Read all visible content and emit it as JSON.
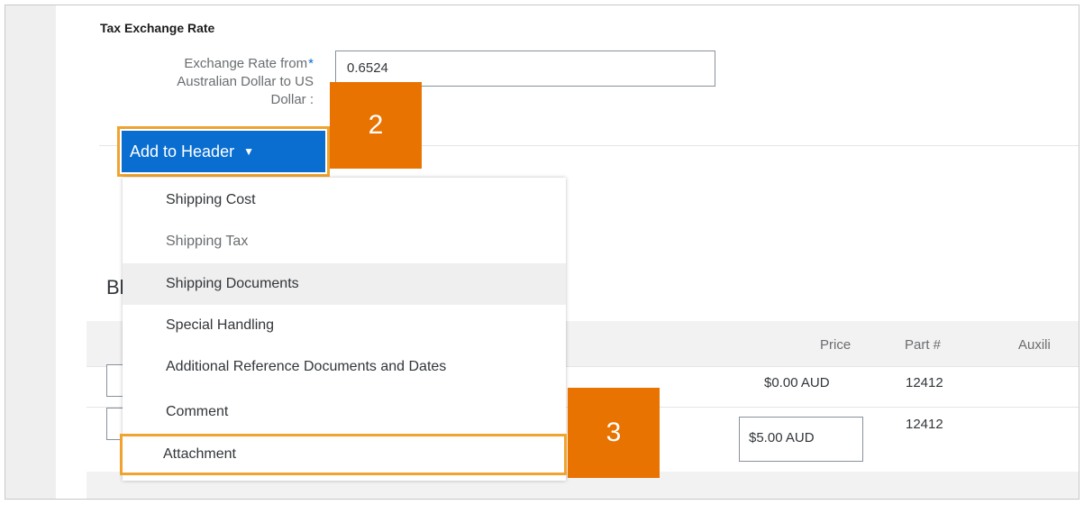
{
  "tax_exchange": {
    "title": "Tax Exchange Rate",
    "rate_label_line1": "Exchange Rate from",
    "rate_label_line2": "Australian Dollar to US",
    "rate_label_line3": "Dollar :",
    "required_mark": "*",
    "rate_value": "0.6524"
  },
  "add_to_header": {
    "label": "Add to Header",
    "caret": "▼"
  },
  "menu": {
    "items": [
      {
        "label": "Shipping Cost"
      },
      {
        "label": "Shipping Tax"
      },
      {
        "label": "Shipping Documents"
      },
      {
        "label": "Special Handling"
      },
      {
        "label": "Additional Reference Documents and Dates"
      },
      {
        "label": "Comment"
      },
      {
        "label": "Attachment"
      }
    ]
  },
  "callouts": {
    "step2": "2",
    "step3": "3"
  },
  "lines_section": {
    "title_partial": "Bl"
  },
  "table": {
    "headers": {
      "price": "Price",
      "part": "Part #",
      "aux": "Auxili"
    },
    "rows": [
      {
        "price": "$0.00 AUD",
        "part": "12412"
      },
      {
        "price": "$5.00 AUD",
        "part": "12412"
      }
    ]
  },
  "colors": {
    "accent_blue": "#0a6ed1",
    "callout_orange": "#e87300",
    "highlight_border": "#f0a32e"
  }
}
